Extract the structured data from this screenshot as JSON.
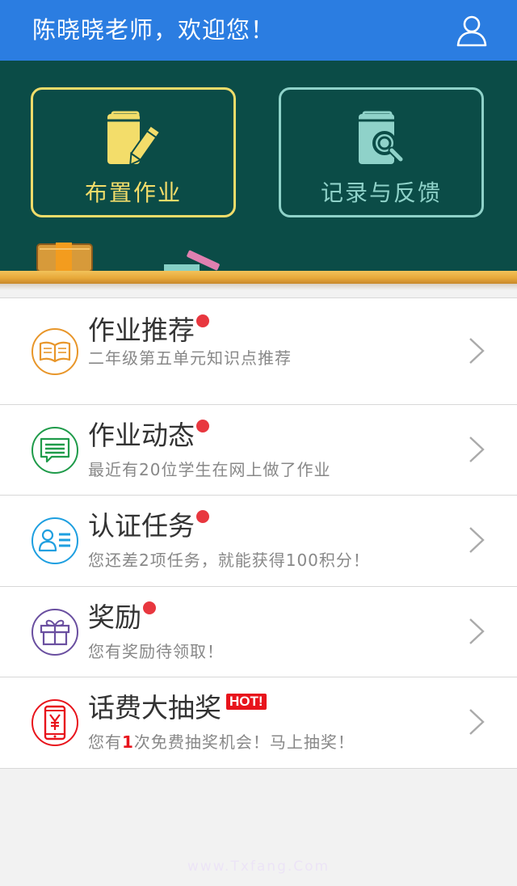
{
  "header": {
    "greeting": "陈晓晓老师，欢迎您！",
    "user_icon": "user-icon"
  },
  "board": {
    "assign": {
      "label": "布置作业",
      "icon": "book-pencil-icon",
      "color": "#f3dd6a"
    },
    "record": {
      "label": "记录与反馈",
      "icon": "book-search-icon",
      "color": "#8fd2c9"
    }
  },
  "list": {
    "items": [
      {
        "title": "作业推荐",
        "subtitle": "二年级第五单元知识点推荐",
        "icon": "open-book-icon",
        "color": "#e8962a",
        "badge": "dot"
      },
      {
        "title": "作业动态",
        "subtitle": "最近有20位学生在网上做了作业",
        "icon": "message-icon",
        "color": "#1f9b4a",
        "badge": "dot"
      },
      {
        "title": "认证任务",
        "subtitle": "您还差2项任务，就能获得100积分！",
        "icon": "id-card-icon",
        "color": "#1e9fe0",
        "badge": "dot"
      },
      {
        "title": "奖励",
        "subtitle": "您有奖励待领取！",
        "icon": "gift-icon",
        "color": "#6a4fa0",
        "badge": "dot"
      },
      {
        "title": "话费大抽奖",
        "badge_text": "HOT!",
        "subtitle_pre": "您有",
        "subtitle_hl": "1",
        "subtitle_post": "次免费抽奖机会！马上抽奖！",
        "icon": "phone-yen-icon",
        "color": "#e8141c"
      }
    ]
  },
  "watermark": "www.Txfang.Com"
}
